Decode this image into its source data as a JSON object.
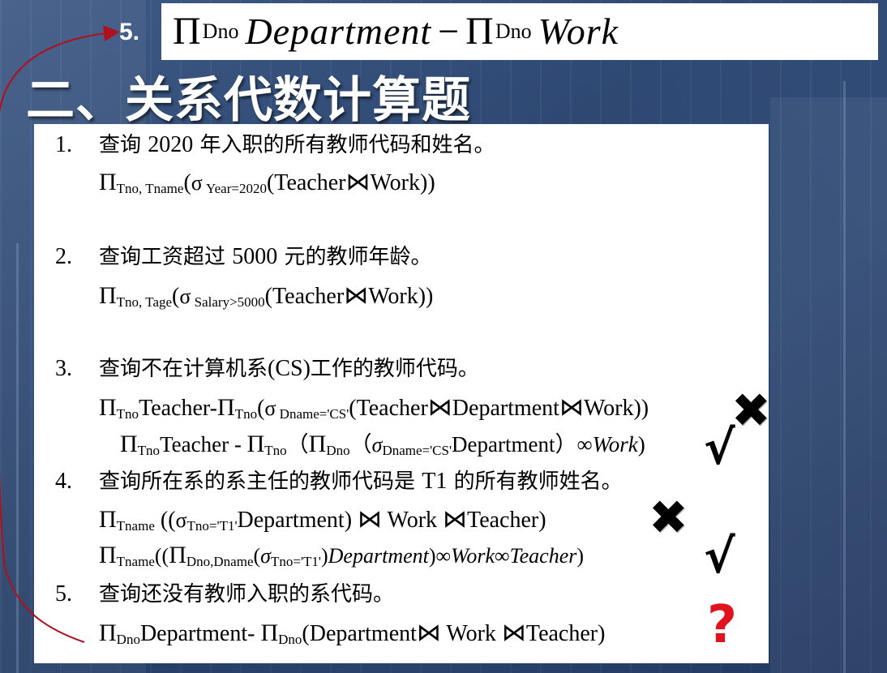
{
  "header": {
    "label": "5.",
    "formula": {
      "pi1": "Π",
      "sub1": "Dno",
      "rel1": "Department",
      "minus": "−",
      "pi2": "Π",
      "sub2": "Dno",
      "rel2": "Work"
    }
  },
  "title": "二、关系代数计算题",
  "questions": [
    {
      "num": "1.",
      "text_a": "查询 ",
      "year": "2020",
      "text_b": " 年入职的所有教师代码和姓名。"
    },
    {
      "num": "2.",
      "text_a": "查询工资超过 ",
      "amount": "5000",
      "text_b": " 元的教师年龄。"
    },
    {
      "num": "3.",
      "text_a": "查询不在计算机系",
      "code": "(CS)",
      "text_b": "工作的教师代码。"
    },
    {
      "num": "4.",
      "text_a": "查询所在系的系主任的教师代码是 ",
      "code": "T1",
      "text_b": " 的所有教师姓名。"
    },
    {
      "num": "5.",
      "text_a": "查询还没有教师入职的系代码。"
    }
  ],
  "answers": {
    "a1": {
      "pi": "Π",
      "sub": "Tno, Tname",
      "open": "(",
      "sigma": "σ",
      "cond": " Year=2020",
      "body_a": "(Teacher",
      "bowtie": "⋈",
      "body_b": "Work))"
    },
    "a2": {
      "pi": "Π",
      "sub": "Tno, Tage",
      "open": "(",
      "sigma": "σ",
      "cond": " Salary>5000",
      "body_a": "(Teacher",
      "bowtie": "⋈",
      "body_b": "Work))"
    },
    "a3": {
      "pi1": "Π",
      "sub1": "Tno",
      "mid": "Teacher-",
      "pi2": "Π",
      "sub2": "Tno",
      "open": "(",
      "sigma": "σ",
      "cond": " Dname='CS'",
      "body_a": "(Teacher",
      "bowtie1": "⋈",
      "body_b": "Department",
      "bowtie2": "⋈",
      "body_c": "Work))"
    },
    "a3b": {
      "pi1": "Π",
      "sub1": "Tno",
      "mid": "Teacher - ",
      "pi2": "Π",
      "sub2": "Tno",
      "open1": "（",
      "pi3": "Π",
      "sub3": "Dno",
      "open2": "（",
      "sigma": "σ",
      "cond": "Dname='CS'",
      "rel": "Department）",
      "join": "∞",
      "rel2": "Work",
      "close": ")"
    },
    "a4": {
      "pi": "Π",
      "sub": "Tname",
      "open": " ((",
      "sigma": "σ",
      "cond": "Tno='T1'",
      "rel": "Department) ",
      "bowtie1": "⋈",
      "work": " Work ",
      "bowtie2": "⋈",
      "rel2": "Teacher)"
    },
    "a4b": {
      "pi1": "Π",
      "sub1": "Tname",
      "open": "((",
      "pi2": "Π",
      "sub2": "Dno,Dname",
      "open2": "(",
      "sigma": "σ",
      "cond": "Tno='T1'",
      "close2": ")",
      "rel": "Department",
      "close1": ")",
      "join1": "∞",
      "rel2": "Work",
      "join2": "∞",
      "rel3": "Teacher",
      "close": ")"
    },
    "a5": {
      "pi1": "Π",
      "sub1": "Dno",
      "mid": "Department- ",
      "pi2": "Π",
      "sub2": "Dno",
      "body_a": "(Department",
      "bowtie1": "⋈",
      "work": " Work ",
      "bowtie2": "⋈",
      "body_b": "Teacher)"
    }
  },
  "marks": {
    "cross": "✖",
    "check": "√",
    "question": "?"
  },
  "colors": {
    "arrow": "#b0101e",
    "question_mark": "#e0141e",
    "title_text": "#ffffff"
  }
}
